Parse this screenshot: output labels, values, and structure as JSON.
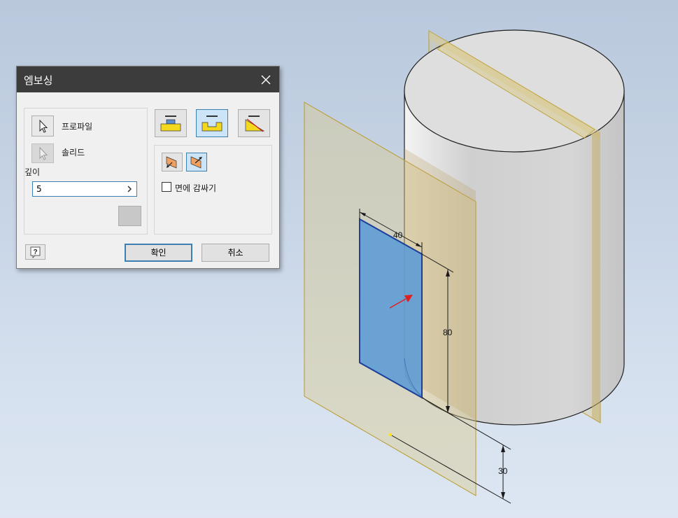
{
  "dialog": {
    "title": "엠보싱",
    "profile_label": "프로파일",
    "solid_label": "솔리드",
    "depth_label": "깊이",
    "depth_value": "5",
    "wrap_face_label": "면에 감싸기",
    "wrap_face_checked": false,
    "ok_label": "확인",
    "cancel_label": "취소"
  },
  "model": {
    "dim_width": "40",
    "dim_height": "80",
    "dim_offset": "30"
  },
  "colors": {
    "title_bar": "#3c3c3c",
    "selected_button": "#cce4f7",
    "profile_fill": "#5b9bd5",
    "work_plane": "#d9c98a",
    "direction_arrow": "#e02020"
  }
}
